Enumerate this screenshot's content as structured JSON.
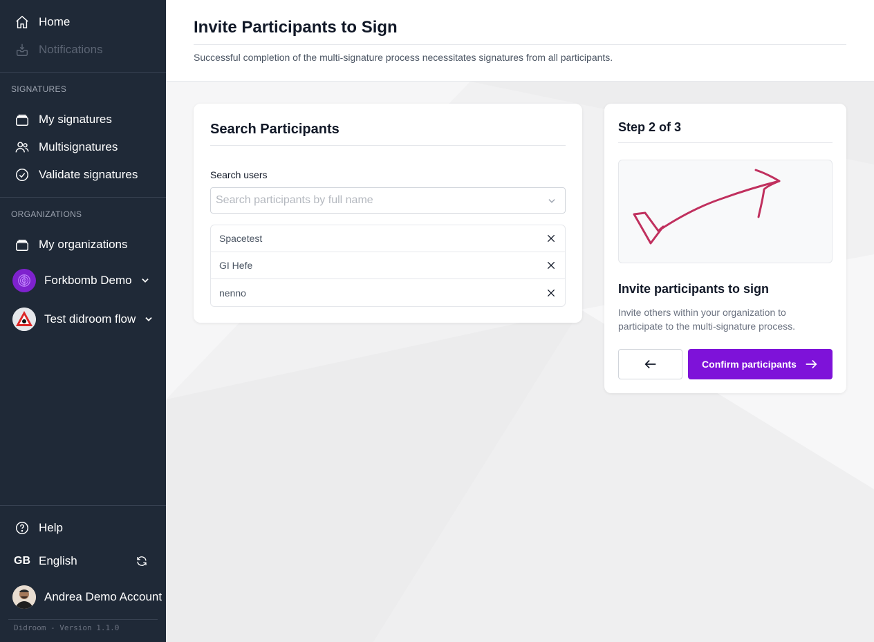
{
  "sidebar": {
    "home": "Home",
    "notifications": "Notifications",
    "signatures_section": "SIGNATURES",
    "my_signatures": "My signatures",
    "multisignatures": "Multisignatures",
    "validate_signatures": "Validate signatures",
    "organizations_section": "ORGANIZATIONS",
    "my_organizations": "My organizations",
    "orgs": [
      {
        "name": "Forkbomb Demo"
      },
      {
        "name": "Test didroom flow"
      }
    ],
    "help": "Help",
    "language_code": "GB",
    "language": "English",
    "account": "Andrea Demo Account",
    "version": "Didroom - Version 1.1.0"
  },
  "header": {
    "title": "Invite Participants to Sign",
    "subtitle": "Successful completion of the multi-signature process necessitates signatures from all participants."
  },
  "search": {
    "title": "Search Participants",
    "label": "Search users",
    "placeholder": "Search participants by full name",
    "participants": [
      "Spacetest",
      "GI Hefe",
      "nenno"
    ]
  },
  "step": {
    "title": "Step 2 of 3",
    "heading": "Invite participants to sign",
    "description": "Invite others within your organization to participate to the multi-signature process.",
    "confirm_label": "Confirm participants"
  },
  "colors": {
    "sidebar_bg": "#1f2937",
    "accent": "#7e12d9",
    "illustration_stroke": "#c0305e"
  }
}
